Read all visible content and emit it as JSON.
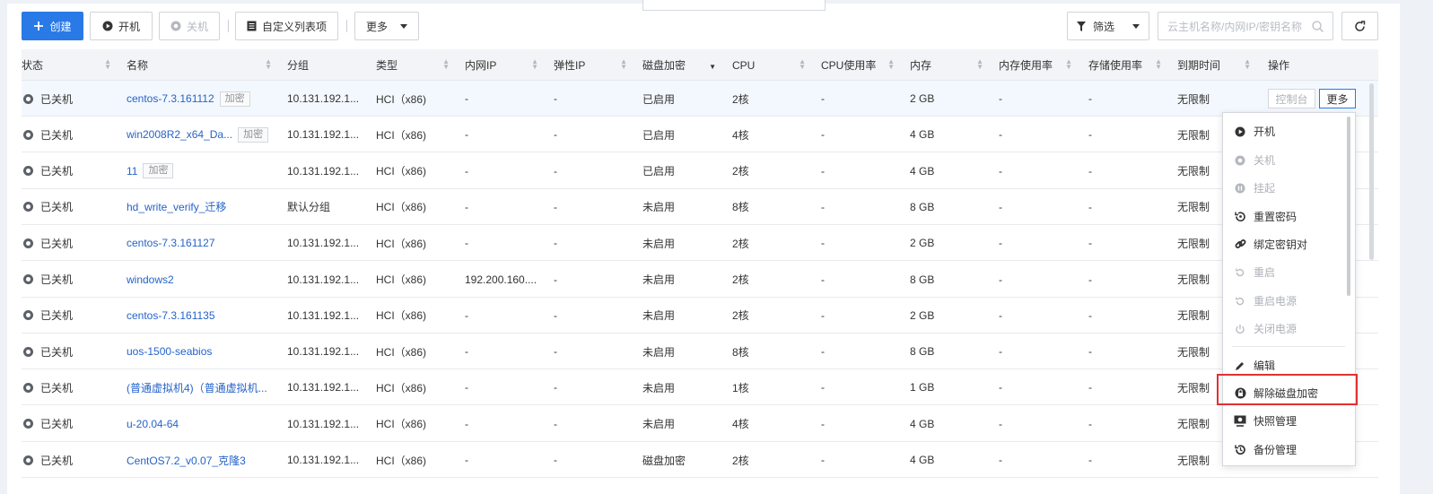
{
  "toolbar": {
    "create_label": "创建",
    "power_on_label": "开机",
    "power_off_label": "关机",
    "custom_columns_label": "自定义列表项",
    "more_label": "更多",
    "filter_label": "筛选",
    "search_placeholder": "云主机名称/内网IP/密钥名称"
  },
  "columns": [
    "状态",
    "名称",
    "分组",
    "类型",
    "内网IP",
    "弹性IP",
    "磁盘加密",
    "CPU",
    "CPU使用率",
    "内存",
    "内存使用率",
    "存储使用率",
    "到期时间",
    "操作"
  ],
  "rows": [
    {
      "status": "已关机",
      "name": "centos-7.3.161112",
      "tag": "加密",
      "group": "10.131.192.1...",
      "type": "HCI（x86)",
      "ip": "-",
      "eip": "-",
      "enc": "已启用",
      "cpu": "2核",
      "cpu_use": "-",
      "mem": "2 GB",
      "mem_use": "-",
      "sto_use": "-",
      "expire": "无限制"
    },
    {
      "status": "已关机",
      "name": "win2008R2_x64_Da...",
      "tag": "加密",
      "group": "10.131.192.1...",
      "type": "HCI（x86)",
      "ip": "-",
      "eip": "-",
      "enc": "已启用",
      "cpu": "4核",
      "cpu_use": "-",
      "mem": "4 GB",
      "mem_use": "-",
      "sto_use": "-",
      "expire": "无限制"
    },
    {
      "status": "已关机",
      "name": "11",
      "tag": "加密",
      "group": "10.131.192.1...",
      "type": "HCI（x86)",
      "ip": "-",
      "eip": "-",
      "enc": "已启用",
      "cpu": "2核",
      "cpu_use": "-",
      "mem": "4 GB",
      "mem_use": "-",
      "sto_use": "-",
      "expire": "无限制"
    },
    {
      "status": "已关机",
      "name": "hd_write_verify_迁移",
      "tag": "",
      "group": "默认分组",
      "type": "HCI（x86)",
      "ip": "-",
      "eip": "-",
      "enc": "未启用",
      "cpu": "8核",
      "cpu_use": "-",
      "mem": "8 GB",
      "mem_use": "-",
      "sto_use": "-",
      "expire": "无限制"
    },
    {
      "status": "已关机",
      "name": "centos-7.3.161127",
      "tag": "",
      "group": "10.131.192.1...",
      "type": "HCI（x86)",
      "ip": "-",
      "eip": "-",
      "enc": "未启用",
      "cpu": "2核",
      "cpu_use": "-",
      "mem": "2 GB",
      "mem_use": "-",
      "sto_use": "-",
      "expire": "无限制"
    },
    {
      "status": "已关机",
      "name": "windows2",
      "tag": "",
      "group": "10.131.192.1...",
      "type": "HCI（x86)",
      "ip": "192.200.160....",
      "eip": "-",
      "enc": "未启用",
      "cpu": "2核",
      "cpu_use": "-",
      "mem": "8 GB",
      "mem_use": "-",
      "sto_use": "-",
      "expire": "无限制"
    },
    {
      "status": "已关机",
      "name": "centos-7.3.161135",
      "tag": "",
      "group": "10.131.192.1...",
      "type": "HCI（x86)",
      "ip": "-",
      "eip": "-",
      "enc": "未启用",
      "cpu": "2核",
      "cpu_use": "-",
      "mem": "2 GB",
      "mem_use": "-",
      "sto_use": "-",
      "expire": "无限制"
    },
    {
      "status": "已关机",
      "name": "uos-1500-seabios",
      "tag": "",
      "group": "10.131.192.1...",
      "type": "HCI（x86)",
      "ip": "-",
      "eip": "-",
      "enc": "未启用",
      "cpu": "8核",
      "cpu_use": "-",
      "mem": "8 GB",
      "mem_use": "-",
      "sto_use": "-",
      "expire": "无限制"
    },
    {
      "status": "已关机",
      "name": "(普通虚拟机4)（普通虚拟机...",
      "tag": "",
      "group": "10.131.192.1...",
      "type": "HCI（x86)",
      "ip": "-",
      "eip": "-",
      "enc": "未启用",
      "cpu": "1核",
      "cpu_use": "-",
      "mem": "1 GB",
      "mem_use": "-",
      "sto_use": "-",
      "expire": "无限制"
    },
    {
      "status": "已关机",
      "name": "u-20.04-64",
      "tag": "",
      "group": "10.131.192.1...",
      "type": "HCI（x86)",
      "ip": "-",
      "eip": "-",
      "enc": "未启用",
      "cpu": "4核",
      "cpu_use": "-",
      "mem": "4 GB",
      "mem_use": "-",
      "sto_use": "-",
      "expire": "无限制"
    },
    {
      "status": "已关机",
      "name": "CentOS7.2_v0.07_克隆3",
      "tag": "",
      "group": "10.131.192.1...",
      "type": "HCI（x86)",
      "ip": "-",
      "eip": "-",
      "enc": "磁盘加密",
      "cpu": "2核",
      "cpu_use": "-",
      "mem": "4 GB",
      "mem_use": "-",
      "sto_use": "-",
      "expire": "无限制"
    }
  ],
  "row_actions": {
    "console_label": "控制台",
    "more_label": "更多"
  },
  "menu": {
    "items": [
      {
        "label": "开机",
        "icon": "play-circle-icon",
        "disabled": false
      },
      {
        "label": "关机",
        "icon": "power-off-circle-icon",
        "disabled": true
      },
      {
        "label": "挂起",
        "icon": "pause-circle-icon",
        "disabled": true
      },
      {
        "label": "重置密码",
        "icon": "reset-password-icon",
        "disabled": false
      },
      {
        "label": "绑定密钥对",
        "icon": "key-link-icon",
        "disabled": false
      },
      {
        "label": "重启",
        "icon": "restart-icon",
        "disabled": true
      },
      {
        "label": "重启电源",
        "icon": "restart-power-icon",
        "disabled": true
      },
      {
        "label": "关闭电源",
        "icon": "power-icon",
        "disabled": true
      },
      {
        "label": "编辑",
        "icon": "pencil-icon",
        "disabled": false
      },
      {
        "label": "解除磁盘加密",
        "icon": "unlock-disk-icon",
        "disabled": false
      },
      {
        "label": "快照管理",
        "icon": "snapshot-icon",
        "disabled": false
      },
      {
        "label": "备份管理",
        "icon": "backup-icon",
        "disabled": false
      }
    ]
  },
  "colors": {
    "primary": "#2979e6",
    "link": "#2563c9",
    "highlight": "#e0312f"
  }
}
